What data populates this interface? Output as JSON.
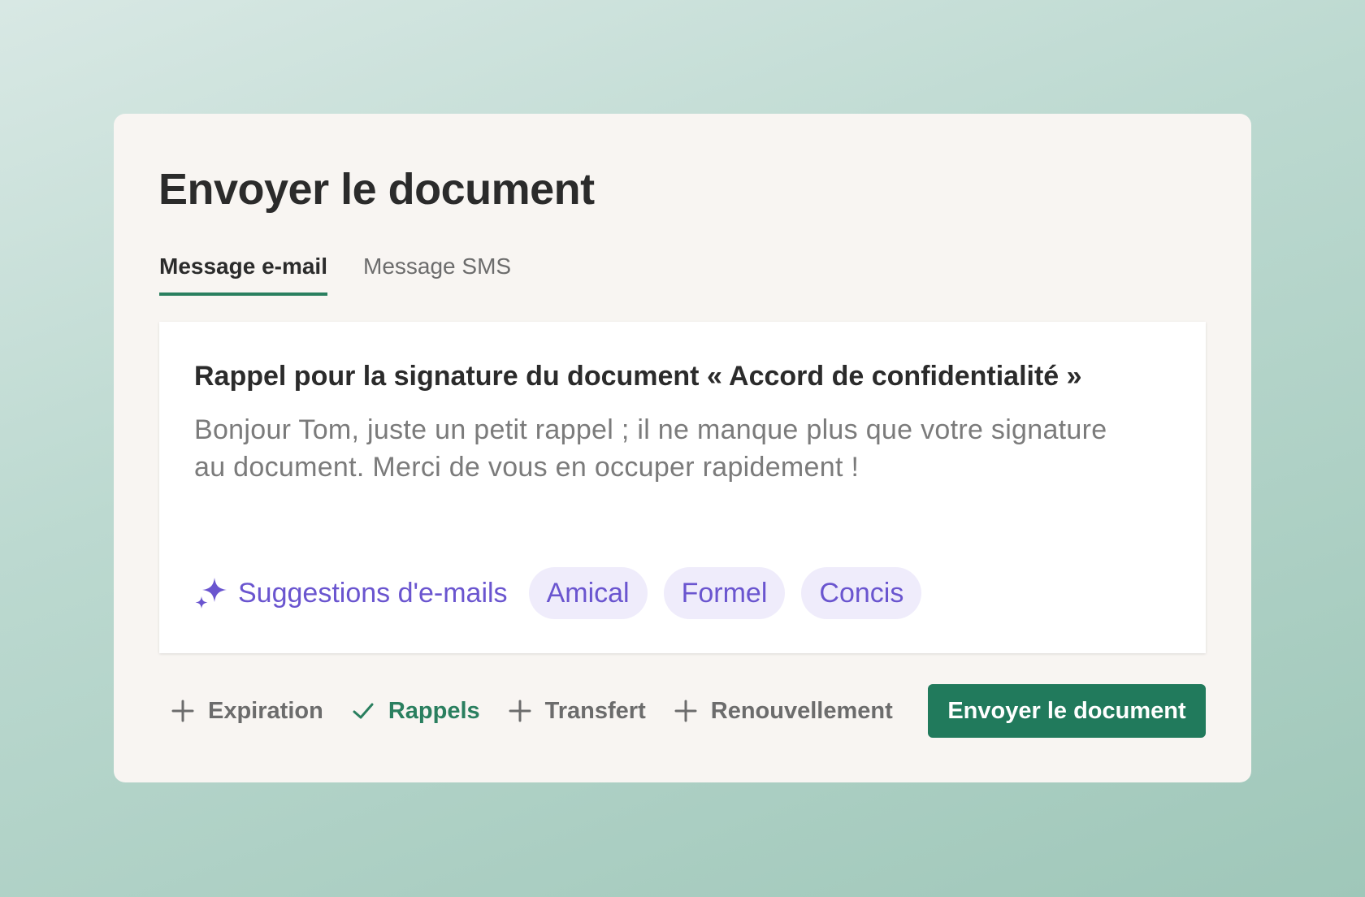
{
  "dialog": {
    "title": "Envoyer le document"
  },
  "tabs": [
    {
      "label": "Message e-mail",
      "active": true
    },
    {
      "label": "Message SMS",
      "active": false
    }
  ],
  "message": {
    "subject": "Rappel pour la signature du document « Accord de confidentialité »",
    "body": "Bonjour Tom, juste un petit rappel ; il ne manque plus que votre signature au document. Merci de vous en occuper rapidement !"
  },
  "suggestions": {
    "label": "Suggestions d'e-mails",
    "icon": "sparkle-icon",
    "chips": [
      "Amical",
      "Formel",
      "Concis"
    ]
  },
  "options": [
    {
      "label": "Expiration",
      "icon": "plus-icon",
      "checked": false
    },
    {
      "label": "Rappels",
      "icon": "check-icon",
      "checked": true
    },
    {
      "label": "Transfert",
      "icon": "plus-icon",
      "checked": false
    },
    {
      "label": "Renouvellement",
      "icon": "plus-icon",
      "checked": false
    }
  ],
  "actions": {
    "send_label": "Envoyer le document"
  },
  "colors": {
    "accent_green": "#217a5c",
    "suggestion_purple": "#6a55cf",
    "chip_background": "#efecfb",
    "card_background": "#f8f5f2"
  }
}
